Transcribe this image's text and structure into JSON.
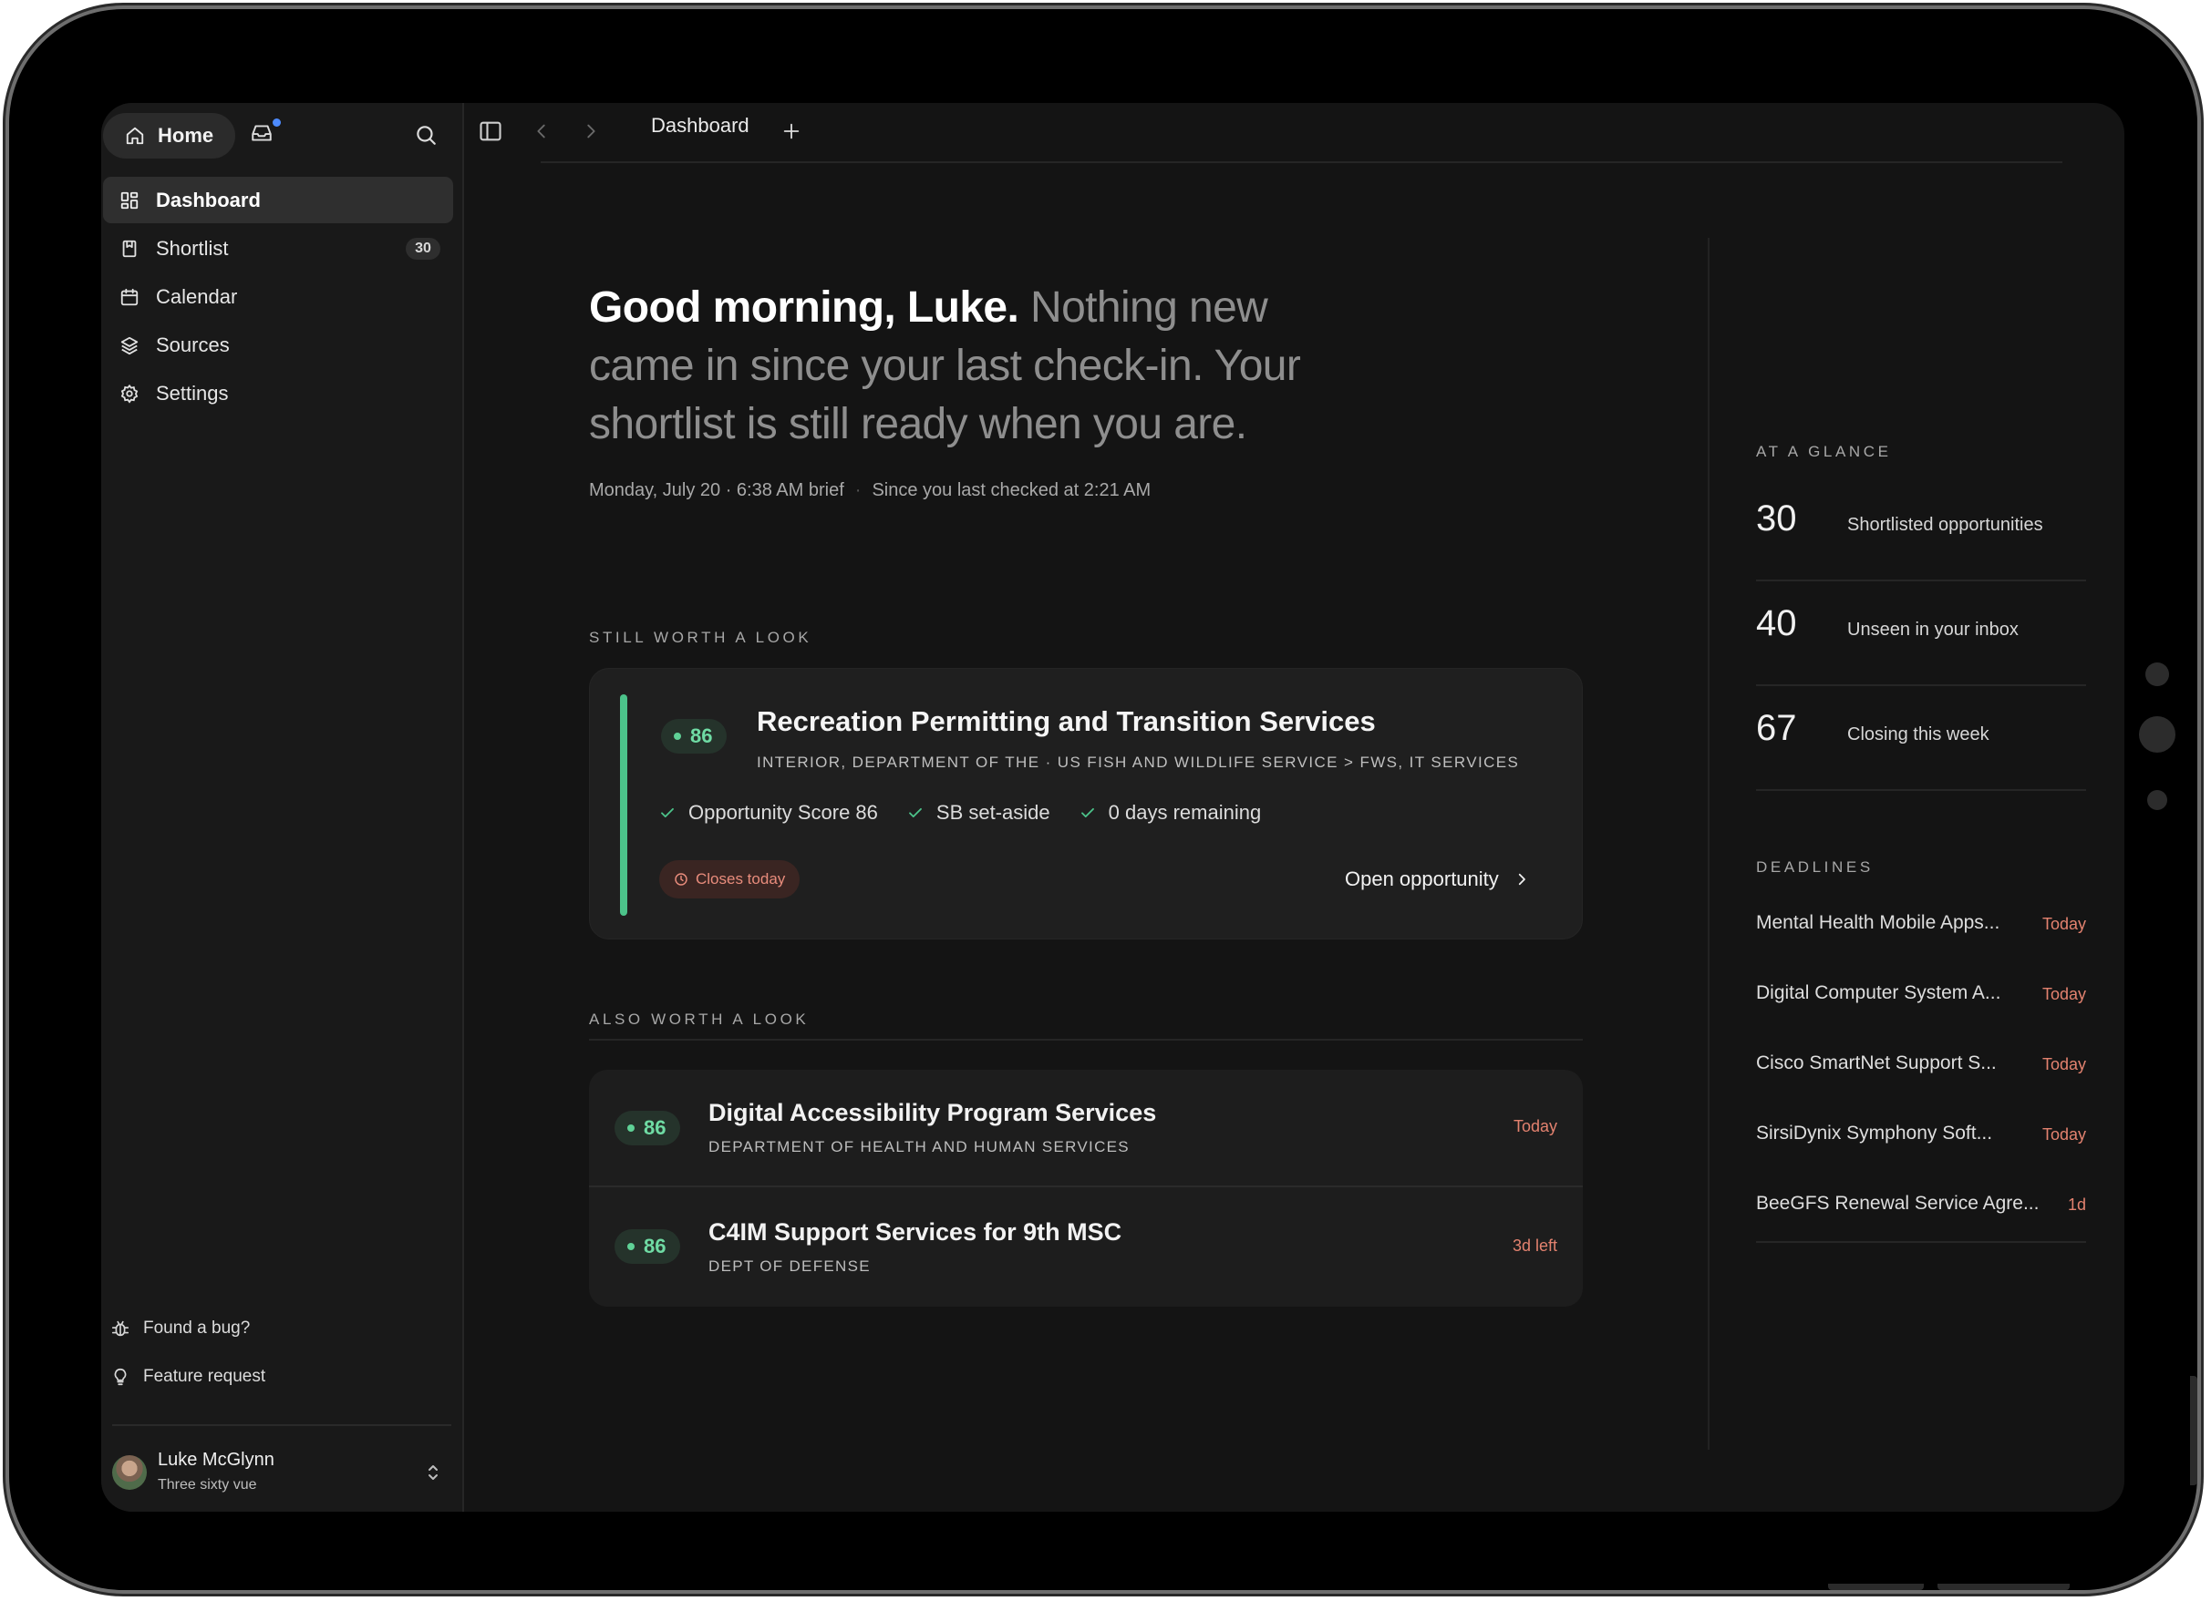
{
  "sidebar": {
    "home_label": "Home",
    "items": [
      {
        "label": "Dashboard",
        "icon": "dashboard-icon",
        "active": true
      },
      {
        "label": "Shortlist",
        "icon": "bookmark-icon",
        "badge": "30"
      },
      {
        "label": "Calendar",
        "icon": "calendar-icon"
      },
      {
        "label": "Sources",
        "icon": "layers-icon"
      },
      {
        "label": "Settings",
        "icon": "gear-icon"
      }
    ],
    "bug_label": "Found a bug?",
    "feature_label": "Feature request",
    "user": {
      "name": "Luke McGlynn",
      "org": "Three sixty vue"
    }
  },
  "topbar": {
    "tab_label": "Dashboard"
  },
  "greeting": {
    "hello": "Good morning, Luke.",
    "message": "Nothing new came in since your last check-in. Your shortlist is still ready when you are.",
    "brief": "Monday, July 20 · 6:38 AM brief",
    "separator": "·",
    "since": "Since you last checked at 2:21 AM"
  },
  "still_worth": {
    "label": "STILL WORTH A LOOK",
    "card": {
      "score": "86",
      "title": "Recreation Permitting and Transition Services",
      "agency": "INTERIOR, DEPARTMENT OF THE · US FISH AND WILDLIFE SERVICE > FWS, IT SERVICES",
      "checks": [
        "Opportunity Score 86",
        "SB set-aside",
        "0 days remaining"
      ],
      "closes": "Closes today",
      "open_label": "Open opportunity"
    }
  },
  "also_worth": {
    "label": "ALSO WORTH A LOOK",
    "rows": [
      {
        "score": "86",
        "title": "Digital Accessibility Program Services",
        "agency": "DEPARTMENT OF HEALTH AND HUMAN SERVICES",
        "deadline": "Today"
      },
      {
        "score": "86",
        "title": "C4IM Support Services for 9th MSC",
        "agency": "DEPT OF DEFENSE",
        "deadline": "3d left"
      }
    ]
  },
  "glance": {
    "label": "AT A GLANCE",
    "stats": [
      {
        "value": "30",
        "text": "Shortlisted opportunities"
      },
      {
        "value": "40",
        "text": "Unseen in your inbox"
      },
      {
        "value": "67",
        "text": "Closing this week"
      }
    ]
  },
  "deadlines": {
    "label": "DEADLINES",
    "items": [
      {
        "name": "Mental Health Mobile Apps...",
        "when": "Today"
      },
      {
        "name": "Digital Computer System A...",
        "when": "Today"
      },
      {
        "name": "Cisco SmartNet Support S...",
        "when": "Today"
      },
      {
        "name": "SirsiDynix Symphony Soft...",
        "when": "Today"
      },
      {
        "name": "BeeGFS Renewal Service Agre...",
        "when": "1d"
      }
    ]
  },
  "colors": {
    "accent_green": "#4cc38a",
    "deadline_red": "#e3826f",
    "notification_blue": "#4d8bff"
  }
}
